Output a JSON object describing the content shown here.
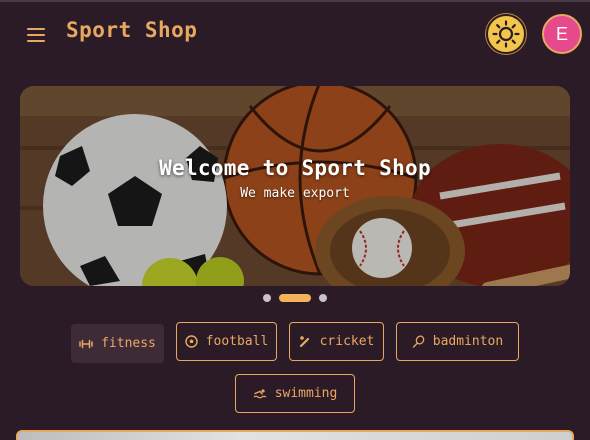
{
  "header": {
    "brand": "Sport Shop",
    "avatar_initial": "E"
  },
  "hero": {
    "title": "Welcome to Sport Shop",
    "subtitle": "We make export"
  },
  "carousel": {
    "slide_count": 3,
    "active_index": 1
  },
  "categories": [
    {
      "label": "fitness",
      "icon": "dumbbell-icon",
      "active": true
    },
    {
      "label": "football",
      "icon": "football-icon",
      "active": false
    },
    {
      "label": "cricket",
      "icon": "cricket-icon",
      "active": false
    },
    {
      "label": "badminton",
      "icon": "badminton-icon",
      "active": false
    },
    {
      "label": "swimming",
      "icon": "swimming-icon",
      "active": false
    }
  ],
  "colors": {
    "background": "#2b1b27",
    "accent": "#e9a862",
    "avatar": "#e64a8c",
    "theme_toggle": "#f3c64a"
  }
}
